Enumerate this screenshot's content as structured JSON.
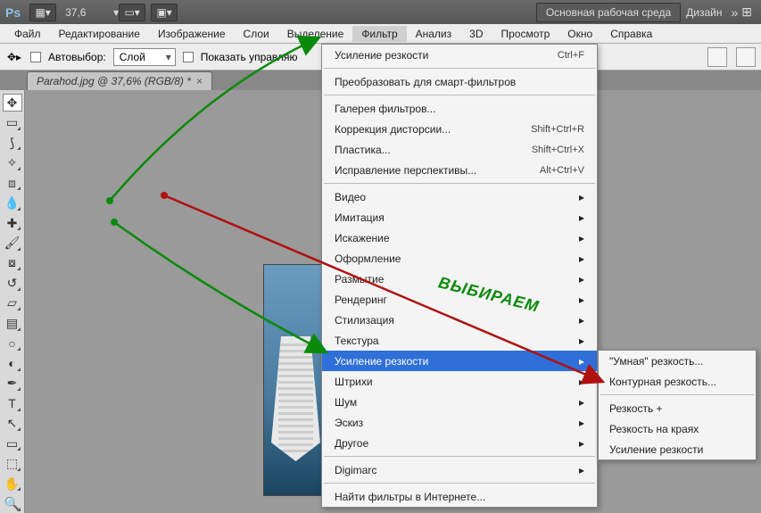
{
  "titlebar": {
    "logo": "Ps",
    "zoom": "37,6",
    "workspace_btn": "Основная рабочая среда",
    "design_link": "Дизайн"
  },
  "menubar": [
    "Файл",
    "Редактирование",
    "Изображение",
    "Слои",
    "Выделение",
    "Фильтр",
    "Анализ",
    "3D",
    "Просмотр",
    "Окно",
    "Справка"
  ],
  "active_menu_index": 5,
  "optionsbar": {
    "autoselect_label": "Автовыбор:",
    "combo_value": "Слой",
    "show_controls_label": "Показать управляю"
  },
  "tab": {
    "label": "Parahod.jpg @ 37,6% (RGB/8) *"
  },
  "dropdown": {
    "items": [
      {
        "label": "Усиление резкости",
        "shortcut": "Ctrl+F"
      },
      {
        "sep": true
      },
      {
        "label": "Преобразовать для смарт-фильтров"
      },
      {
        "sep": true
      },
      {
        "label": "Галерея фильтров..."
      },
      {
        "label": "Коррекция дисторсии...",
        "shortcut": "Shift+Ctrl+R"
      },
      {
        "label": "Пластика...",
        "shortcut": "Shift+Ctrl+X"
      },
      {
        "label": "Исправление перспективы...",
        "shortcut": "Alt+Ctrl+V"
      },
      {
        "sep": true
      },
      {
        "label": "Видео",
        "submenu": true
      },
      {
        "label": "Имитация",
        "submenu": true
      },
      {
        "label": "Искажение",
        "submenu": true
      },
      {
        "label": "Оформление",
        "submenu": true
      },
      {
        "label": "Размытие",
        "submenu": true
      },
      {
        "label": "Рендеринг",
        "submenu": true
      },
      {
        "label": "Стилизация",
        "submenu": true
      },
      {
        "label": "Текстура",
        "submenu": true
      },
      {
        "label": "Усиление резкости",
        "submenu": true,
        "hot": true
      },
      {
        "label": "Штрихи",
        "submenu": true
      },
      {
        "label": "Шум",
        "submenu": true
      },
      {
        "label": "Эскиз",
        "submenu": true
      },
      {
        "label": "Другое",
        "submenu": true
      },
      {
        "sep": true
      },
      {
        "label": "Digimarc",
        "submenu": true
      },
      {
        "sep": true
      },
      {
        "label": "Найти фильтры в Интернете..."
      }
    ]
  },
  "submenu": {
    "items": [
      {
        "label": "\"Умная\" резкость..."
      },
      {
        "label": "Контурная резкость..."
      },
      {
        "sep": true
      },
      {
        "label": "Резкость +"
      },
      {
        "label": "Резкость на краях"
      },
      {
        "label": "Усиление резкости"
      }
    ]
  },
  "annotation": "ВЫБИРАЕМ",
  "tools": [
    "move",
    "marquee",
    "lasso",
    "wand",
    "crop",
    "eyedrop",
    "heal",
    "brush",
    "stamp",
    "history",
    "eraser",
    "gradient",
    "blur",
    "dodge",
    "pen",
    "type",
    "path",
    "shape",
    "3d",
    "hand",
    "zoom"
  ]
}
